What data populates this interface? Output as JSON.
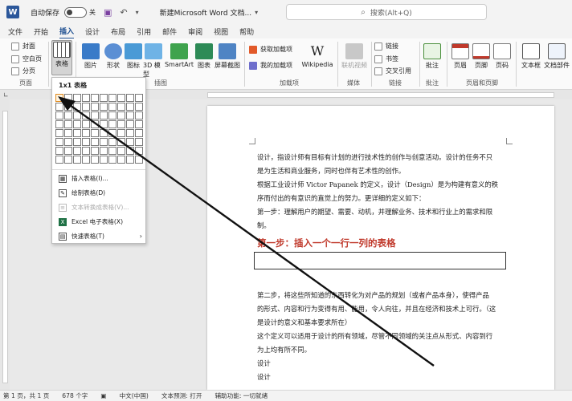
{
  "titlebar": {
    "autosave_label": "自动保存",
    "toggle_state": "关",
    "doc_title": "新建Microsoft Word 文档...",
    "search_placeholder": "搜索(Alt+Q)"
  },
  "tabs": [
    "文件",
    "开始",
    "插入",
    "设计",
    "布局",
    "引用",
    "邮件",
    "审阅",
    "视图",
    "帮助"
  ],
  "active_tab": "插入",
  "ribbon": {
    "pages_group": {
      "label": "页面",
      "items": [
        "封面",
        "空白页",
        "分页"
      ]
    },
    "table_button": "表格",
    "illustrations": {
      "label": "插图",
      "items": [
        "图片",
        "形状",
        "图标",
        "3D 模型",
        "SmartArt",
        "图表",
        "屏幕截图"
      ]
    },
    "addins": {
      "label": "加载项",
      "items": [
        "获取加载项",
        "我的加载项"
      ]
    },
    "wikipedia": "Wikipedia",
    "media": {
      "label": "媒体",
      "item": "联机视频"
    },
    "links": {
      "label": "链接",
      "items": [
        "链接",
        "书签",
        "交叉引用"
      ]
    },
    "comments": {
      "label": "批注",
      "item": "批注"
    },
    "header_footer": {
      "label": "页眉和页脚",
      "items": [
        "页眉",
        "页脚",
        "页码"
      ]
    },
    "text": {
      "items": [
        "文本框",
        "文档部件"
      ]
    }
  },
  "dropdown": {
    "title": "1x1 表格",
    "items": [
      {
        "label": "插入表格(I)...",
        "icon": "insert-table-icon",
        "disabled": false
      },
      {
        "label": "绘制表格(D)",
        "icon": "draw-table-icon",
        "disabled": false
      },
      {
        "label": "文本转换成表格(V)...",
        "icon": "convert-text-icon",
        "disabled": true
      },
      {
        "label": "Excel 电子表格(X)",
        "icon": "excel-icon",
        "disabled": false
      },
      {
        "label": "快速表格(T)",
        "icon": "quick-tables-icon",
        "disabled": false
      }
    ]
  },
  "document": {
    "paragraphs_top": [
      "设计，指设计师有目标有计划的进行技术性的创作与创意活动。设计的任务不只",
      "是为生活和商业服务，同时也伴有艺术性的创作。",
      "根据工业设计师 Victor Papanek 的定义，设计（Design）是为构建有意义的秩",
      "序而付出的有意识的直觉上的努力。更详细的定义如下：",
      "第一步：理解用户的期望、需要、动机，并理解业务、技术和行业上的需求和限",
      "制。"
    ],
    "heading": "第一步：插入一个一行一列的表格",
    "paragraphs_bottom": [
      "第二步，将这些所知道的东西转化为对产品的规划（或者产品本身），使得产品",
      "的形式、内容和行为变得有用、能用，令人向往，并且在经济和技术上可行。（这",
      "是设计的意义和基本要求所在）",
      "这个定义可以适用于设计的所有领域，尽管不同领域的关注点从形式、内容到行",
      "为上均有所不同。",
      "设计",
      "设计"
    ]
  },
  "status": {
    "page": "第 1 页，共 1 页",
    "words": "678 个字",
    "language": "中文(中国)",
    "prediction": "文本预测: 打开",
    "accessibility": "辅助功能: 一切就绪"
  },
  "colors": {
    "accent": "#1e4f91",
    "heading_red": "#c0392b",
    "word_blue": "#2b579a"
  }
}
